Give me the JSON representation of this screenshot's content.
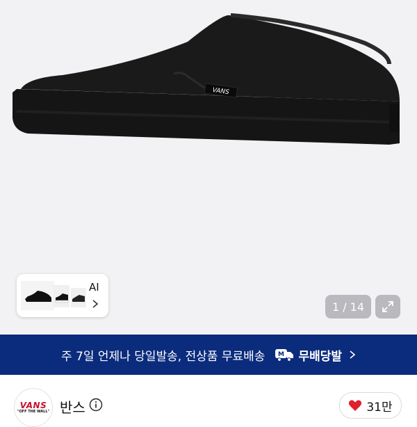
{
  "similar": {
    "ai_label": "AI"
  },
  "gallery": {
    "counter": "1 / 14",
    "current": 1,
    "total": 14
  },
  "promo": {
    "text": "주 7일 언제나 당일발송, 전상품 무료배송",
    "badge_label": "무배당발",
    "badge_icon_letter": "M",
    "bg_color": "#0b2b7d"
  },
  "product_visual": {
    "shoe_logo_text": "VANS",
    "colors": {
      "shoe": "#151515",
      "background": "#f2f2f5"
    }
  },
  "brand": {
    "name": "반스",
    "logo_text": "VANS",
    "logo_subtext": "\"OFF THE WALL\"",
    "logo_color": "#c8102e"
  },
  "likes": {
    "count": "31만",
    "heart_color": "#e0202c"
  }
}
